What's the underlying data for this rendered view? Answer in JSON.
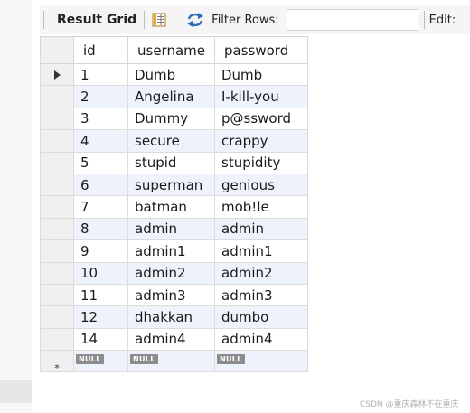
{
  "toolbar": {
    "result_grid_label": "Result Grid",
    "filter_label": "Filter Rows:",
    "filter_value": "",
    "edit_label": "Edit:"
  },
  "grid": {
    "columns": [
      "id",
      "username",
      "password"
    ],
    "rows": [
      [
        "1",
        "Dumb",
        "Dumb"
      ],
      [
        "2",
        "Angelina",
        "I-kill-you"
      ],
      [
        "3",
        "Dummy",
        "p@ssword"
      ],
      [
        "4",
        "secure",
        "crappy"
      ],
      [
        "5",
        "stupid",
        "stupidity"
      ],
      [
        "6",
        "superman",
        "genious"
      ],
      [
        "7",
        "batman",
        "mob!le"
      ],
      [
        "8",
        "admin",
        "admin"
      ],
      [
        "9",
        "admin1",
        "admin1"
      ],
      [
        "10",
        "admin2",
        "admin2"
      ],
      [
        "11",
        "admin3",
        "admin3"
      ],
      [
        "12",
        "dhakkan",
        "dumbo"
      ],
      [
        "14",
        "admin4",
        "admin4"
      ]
    ],
    "new_row": [
      "NULL",
      "NULL",
      "NULL"
    ],
    "new_row_marker": "*"
  },
  "icons": {
    "grid_view": "grid-view-icon",
    "refresh": "refresh-icon",
    "row_pointer": "row-pointer-icon"
  },
  "watermark": "CSDN @重庆森林不在重庆",
  "colors": {
    "alt_row": "#eef3fb",
    "null_badge": "#8c8c8c",
    "refresh_blue": "#2d6db4",
    "grid_icon_orange": "#f0a030"
  }
}
